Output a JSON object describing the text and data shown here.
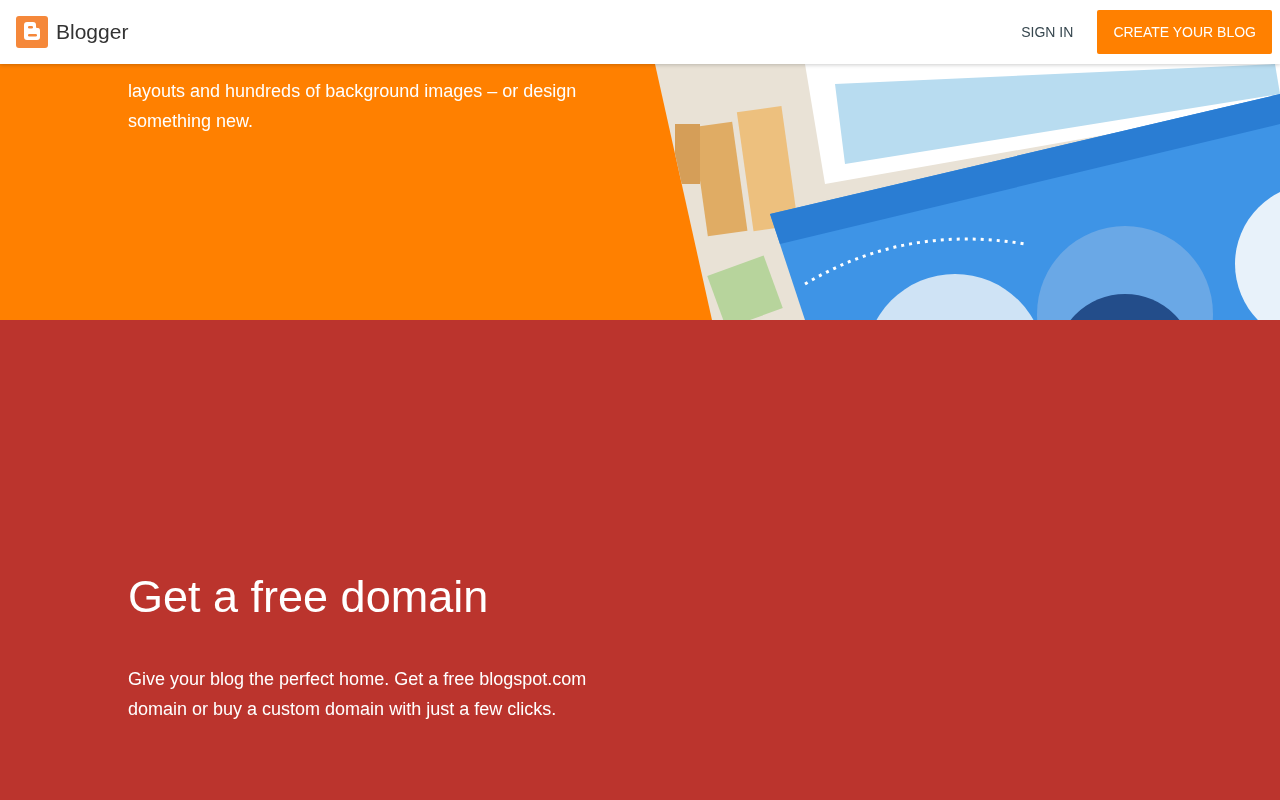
{
  "header": {
    "logo_text": "Blogger",
    "sign_in": "SIGN IN",
    "create_button": "CREATE YOUR BLOG"
  },
  "templates_section": {
    "body_lines": [
      "layouts and hundreds of background images – or design",
      "something new."
    ]
  },
  "domain_section": {
    "heading": "Get a free domain",
    "body": "Give your blog the perfect home. Get a free blogspot.com domain or buy a custom domain with just a few clicks."
  }
}
